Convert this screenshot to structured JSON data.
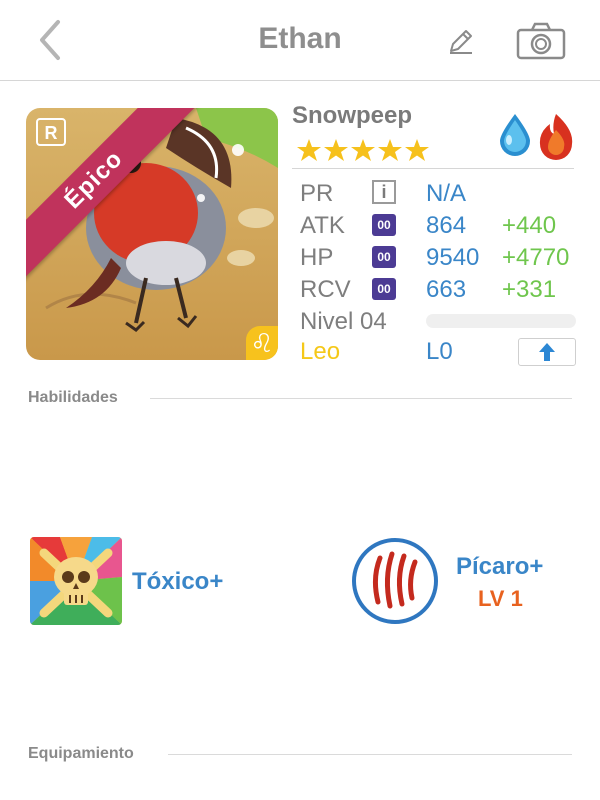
{
  "header": {
    "title": "Ethan",
    "back_icon": "chevron-left-icon",
    "edit_icon": "pencil-icon",
    "camera_icon": "camera-icon"
  },
  "pet": {
    "name": "Snowpeep",
    "rarity": "Épico",
    "stars": 5,
    "elements": [
      "water-drop-icon",
      "fire-icon"
    ],
    "stats": [
      {
        "label": "PR",
        "value": "N/A",
        "bonus": ""
      },
      {
        "label": "ATK",
        "potion": "00",
        "value": "864",
        "bonus": "+440"
      },
      {
        "label": "HP",
        "potion": "00",
        "value": "9540",
        "bonus": "+4770"
      },
      {
        "label": "RCV",
        "potion": "00",
        "value": "663",
        "bonus": "+331"
      }
    ],
    "level_label": "Nivel 04",
    "zodiac": "Leo",
    "limit": "L0"
  },
  "sections": {
    "abilities": "Habilidades",
    "equipment": "Equipamiento"
  },
  "abilities": [
    {
      "name": "Tóxico+",
      "icon": "skull-icon"
    },
    {
      "name": "Pícaro+",
      "level": "LV 1",
      "icon": "claw-scratch-icon"
    }
  ],
  "colors": {
    "accent_blue": "#3a86c8",
    "bonus_green": "#6fc64d",
    "rarity": "#c0335c",
    "zodiac_yellow": "#f5c818",
    "level_orange": "#e8621f"
  }
}
